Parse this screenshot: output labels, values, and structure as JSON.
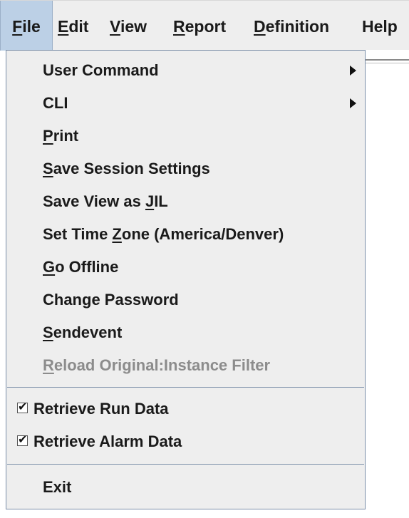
{
  "menubar": {
    "items": [
      {
        "label": "File",
        "mnemonic": "F",
        "open": true
      },
      {
        "label": "Edit",
        "mnemonic": "E"
      },
      {
        "label": "View",
        "mnemonic": "V"
      },
      {
        "label": "Report",
        "mnemonic": "R"
      },
      {
        "label": "Definition",
        "mnemonic": "D"
      },
      {
        "label": "Help"
      }
    ]
  },
  "file_menu": {
    "items": [
      {
        "label": "User Command",
        "submenu": true
      },
      {
        "label": "CLI",
        "submenu": true
      },
      {
        "label": "Print",
        "mnemonic": "P"
      },
      {
        "label": "Save Session Settings",
        "mnemonic": "S"
      },
      {
        "label": "Save View as JIL",
        "mnemonic": "J"
      },
      {
        "label": "Set Time Zone (America/Denver)",
        "mnemonic": "Z"
      },
      {
        "label": "Go Offline",
        "mnemonic": "G"
      },
      {
        "label": "Change Password"
      },
      {
        "label": "Sendevent",
        "mnemonic": "S"
      },
      {
        "label": "Reload Original:Instance Filter",
        "mnemonic": "R",
        "disabled": true
      },
      {
        "label": "Retrieve Run Data",
        "checked": true
      },
      {
        "label": "Retrieve Alarm Data",
        "checked": true
      },
      {
        "label": "Exit"
      }
    ]
  },
  "icons": {
    "submenu": "chevron-right-icon",
    "check": "check-icon"
  },
  "colors": {
    "menu_background": "#eeeeee",
    "selected_menu_background": "#bcd0e6",
    "menu_border": "#7a8ea8",
    "disabled_text": "#8c8c8c"
  }
}
